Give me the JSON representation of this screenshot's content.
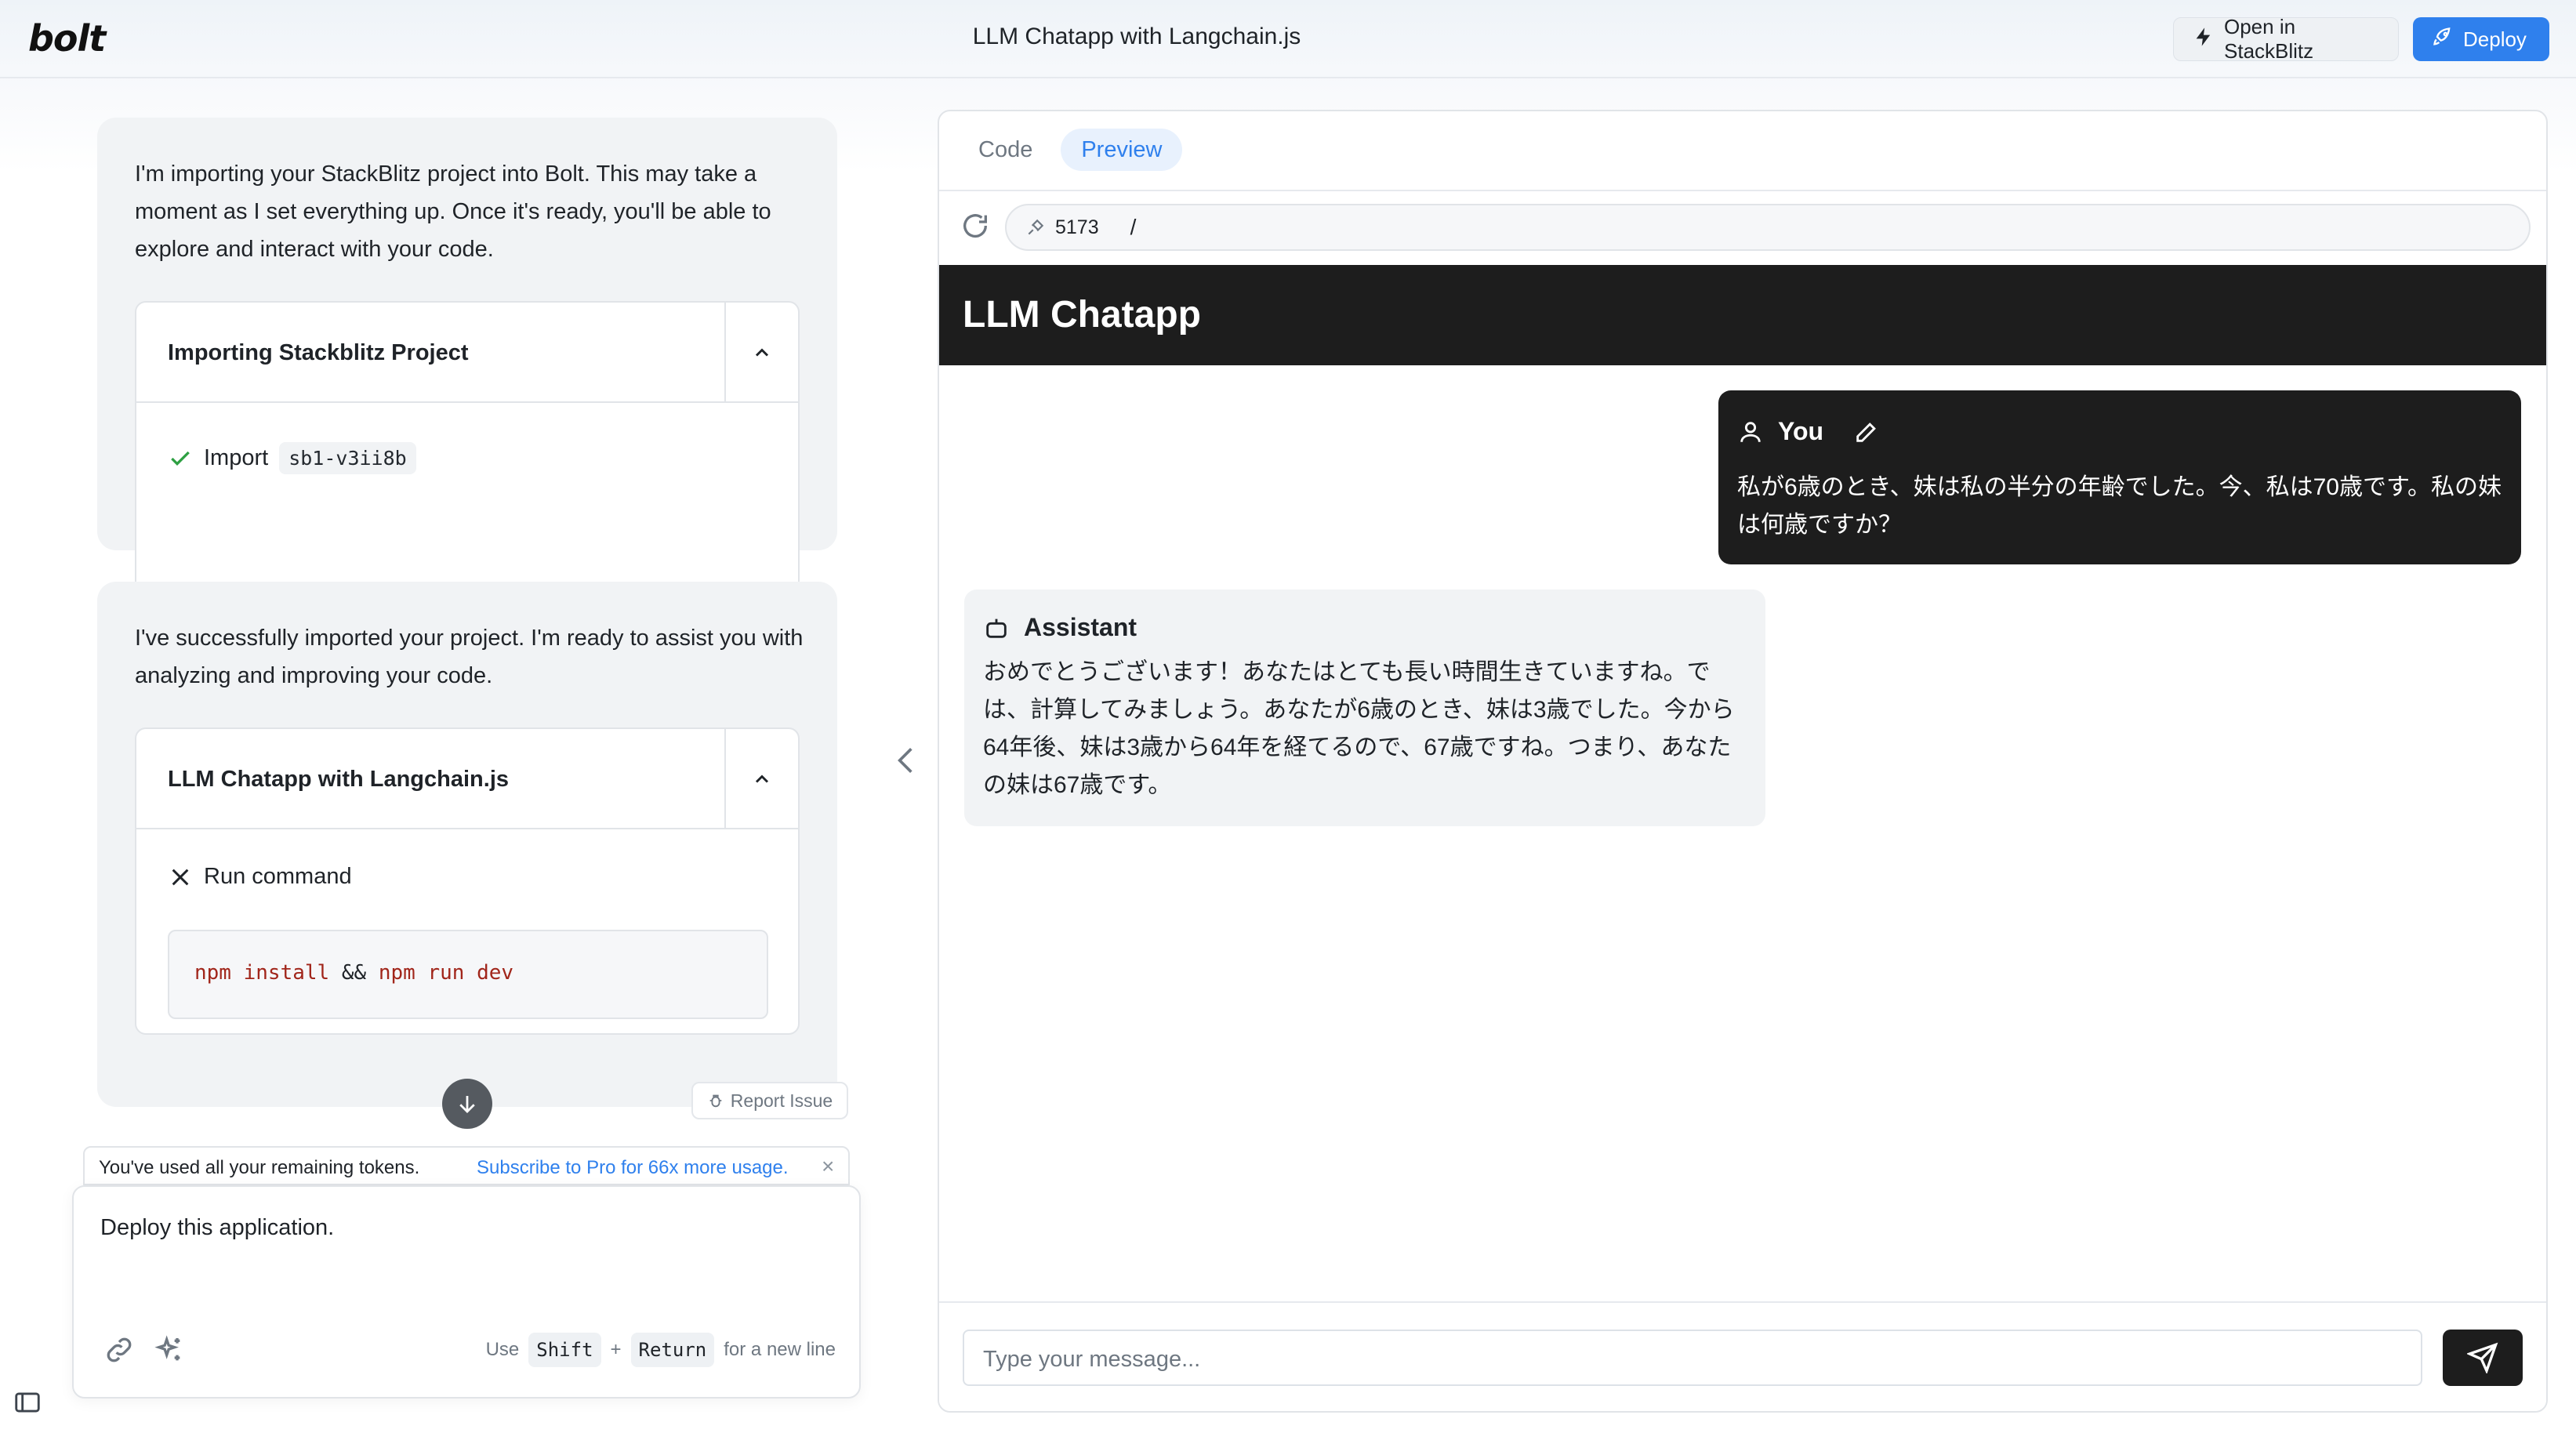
{
  "header": {
    "logo": "bolt",
    "title": "LLM Chatapp with Langchain.js",
    "open_stackblitz_label": "Open in StackBlitz",
    "deploy_label": "Deploy"
  },
  "chat": {
    "messages": [
      {
        "text": "I'm importing your StackBlitz project into Bolt. This may take a moment as I set everything up. Once it's ready, you'll be able to explore and interact with your code.",
        "action_title": "Importing Stackblitz Project",
        "action_row_label": "Import",
        "action_row_code": "sb1-v3ii8b"
      },
      {
        "text": "I've successfully imported your project. I'm ready to assist you with analyzing and improving your code.",
        "action_title": "LLM Chatapp with Langchain.js",
        "action_row_label": "Run command",
        "command": {
          "cmd1": "npm",
          "arg1": "install",
          "op": "&&",
          "cmd2": "npm",
          "arg2": "run dev"
        }
      }
    ],
    "report_issue_label": "Report Issue",
    "token_notice": "You've used all your remaining tokens.",
    "subscribe_link": "Subscribe to Pro for 66x more usage.",
    "input_value": "Deploy this application.",
    "hint": {
      "use": "Use",
      "key1": "Shift",
      "plus": "+",
      "key2": "Return",
      "suffix": "for a new line"
    }
  },
  "workbench": {
    "tabs": [
      "Code",
      "Preview"
    ],
    "active_tab": "Preview",
    "port": "5173",
    "path": "/"
  },
  "preview": {
    "app_title": "LLM Chatapp",
    "user_label": "You",
    "user_message": "私が6歳のとき、妹は私の半分の年齢でした。今、私は70歳です。私の妹は何歳ですか？",
    "assistant_label": "Assistant",
    "assistant_message": "おめでとうございます！あなたはとても長い時間生きていますね。では、計算してみましょう。あなたが6歳のとき、妹は3歳でした。今から64年後、妹は3歳から64年を経てるので、67歳ですね。つまり、あなたの妹は67歳です。",
    "input_placeholder": "Type your message..."
  },
  "colors": {
    "accent": "#2f80ed",
    "dark": "#1d1d1d",
    "card_bg": "#f1f3f5",
    "success": "#2ea043"
  }
}
